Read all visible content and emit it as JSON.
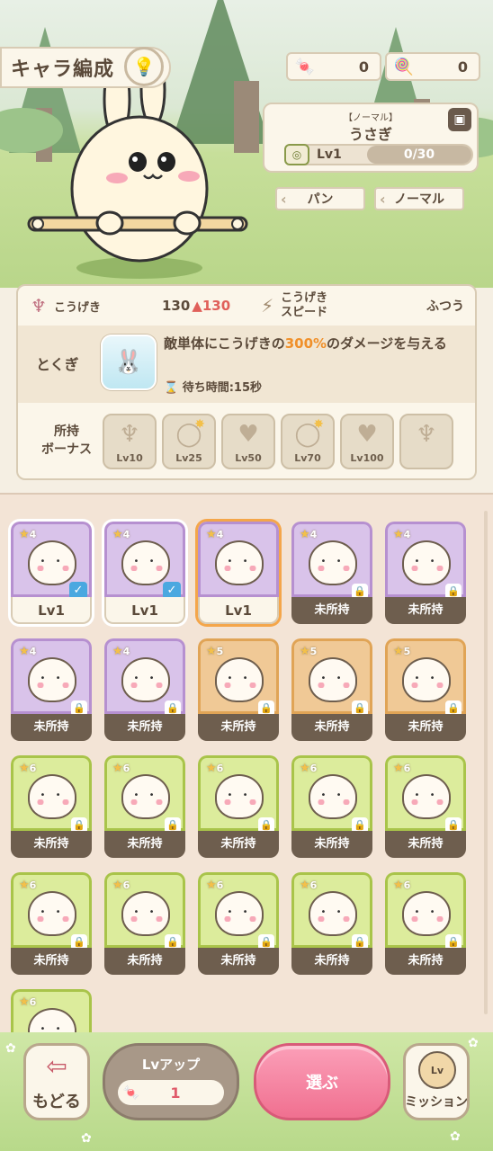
{
  "header": {
    "title": "キャラ編成",
    "currencies": [
      {
        "icon": "candy-icon",
        "value": "0"
      },
      {
        "icon": "lollipop-icon",
        "value": "0"
      }
    ]
  },
  "character": {
    "rarity": "【ノーマル】",
    "name": "うさぎ",
    "level_label": "Lv1",
    "exp": "0/30",
    "tags": [
      "パン",
      "ノーマル"
    ]
  },
  "stats": {
    "attack_label": "こうげき",
    "attack_value": "130",
    "attack_boost": "▲130",
    "speed_label_line1": "こうげき",
    "speed_label_line2": "スピード",
    "speed_value": "ふつう"
  },
  "skill": {
    "label": "とくぎ",
    "desc_before": "敵単体にこうげきの",
    "desc_highlight": "300%",
    "desc_after": "のダメージを与える",
    "wait": "待ち時間:15秒"
  },
  "bonus": {
    "label_line1": "所持",
    "label_line2": "ボーナス",
    "items": [
      {
        "icon": "attack-bonus-icon",
        "level": "Lv10"
      },
      {
        "icon": "ring-bonus-icon",
        "level": "Lv25"
      },
      {
        "icon": "heart-bonus-icon",
        "level": "Lv50"
      },
      {
        "icon": "ring-bonus-icon",
        "level": "Lv70"
      },
      {
        "icon": "heart-bonus-icon",
        "level": "Lv100"
      },
      {
        "icon": "attack-bonus-icon",
        "level": ""
      }
    ]
  },
  "grid": {
    "cards": [
      {
        "stars": "4",
        "rarity": 4,
        "label": "Lv1",
        "owned": true,
        "selected": false,
        "checked": true
      },
      {
        "stars": "4",
        "rarity": 4,
        "label": "Lv1",
        "owned": true,
        "selected": false,
        "checked": true
      },
      {
        "stars": "4",
        "rarity": 4,
        "label": "Lv1",
        "owned": true,
        "selected": true,
        "checked": false
      },
      {
        "stars": "4",
        "rarity": 4,
        "label": "未所持",
        "owned": false
      },
      {
        "stars": "4",
        "rarity": 4,
        "label": "未所持",
        "owned": false
      },
      {
        "stars": "4",
        "rarity": 4,
        "label": "未所持",
        "owned": false
      },
      {
        "stars": "4",
        "rarity": 4,
        "label": "未所持",
        "owned": false
      },
      {
        "stars": "5",
        "rarity": 5,
        "label": "未所持",
        "owned": false
      },
      {
        "stars": "5",
        "rarity": 5,
        "label": "未所持",
        "owned": false
      },
      {
        "stars": "5",
        "rarity": 5,
        "label": "未所持",
        "owned": false
      },
      {
        "stars": "6",
        "rarity": 6,
        "label": "未所持",
        "owned": false
      },
      {
        "stars": "6",
        "rarity": 6,
        "label": "未所持",
        "owned": false
      },
      {
        "stars": "6",
        "rarity": 6,
        "label": "未所持",
        "owned": false
      },
      {
        "stars": "6",
        "rarity": 6,
        "label": "未所持",
        "owned": false
      },
      {
        "stars": "6",
        "rarity": 6,
        "label": "未所持",
        "owned": false
      },
      {
        "stars": "6",
        "rarity": 6,
        "label": "未所持",
        "owned": false
      },
      {
        "stars": "6",
        "rarity": 6,
        "label": "未所持",
        "owned": false
      },
      {
        "stars": "6",
        "rarity": 6,
        "label": "未所持",
        "owned": false
      },
      {
        "stars": "6",
        "rarity": 6,
        "label": "未所持",
        "owned": false
      },
      {
        "stars": "6",
        "rarity": 6,
        "label": "未所持",
        "owned": false
      },
      {
        "stars": "6",
        "rarity": 6,
        "label": "",
        "owned": false
      }
    ]
  },
  "bottom": {
    "back_label": "もどる",
    "lvup_label": "Lvアップ",
    "lvup_cost": "1",
    "select_label": "選ぶ",
    "mission_icon_text": "Lv",
    "mission_label": "ミッション"
  }
}
